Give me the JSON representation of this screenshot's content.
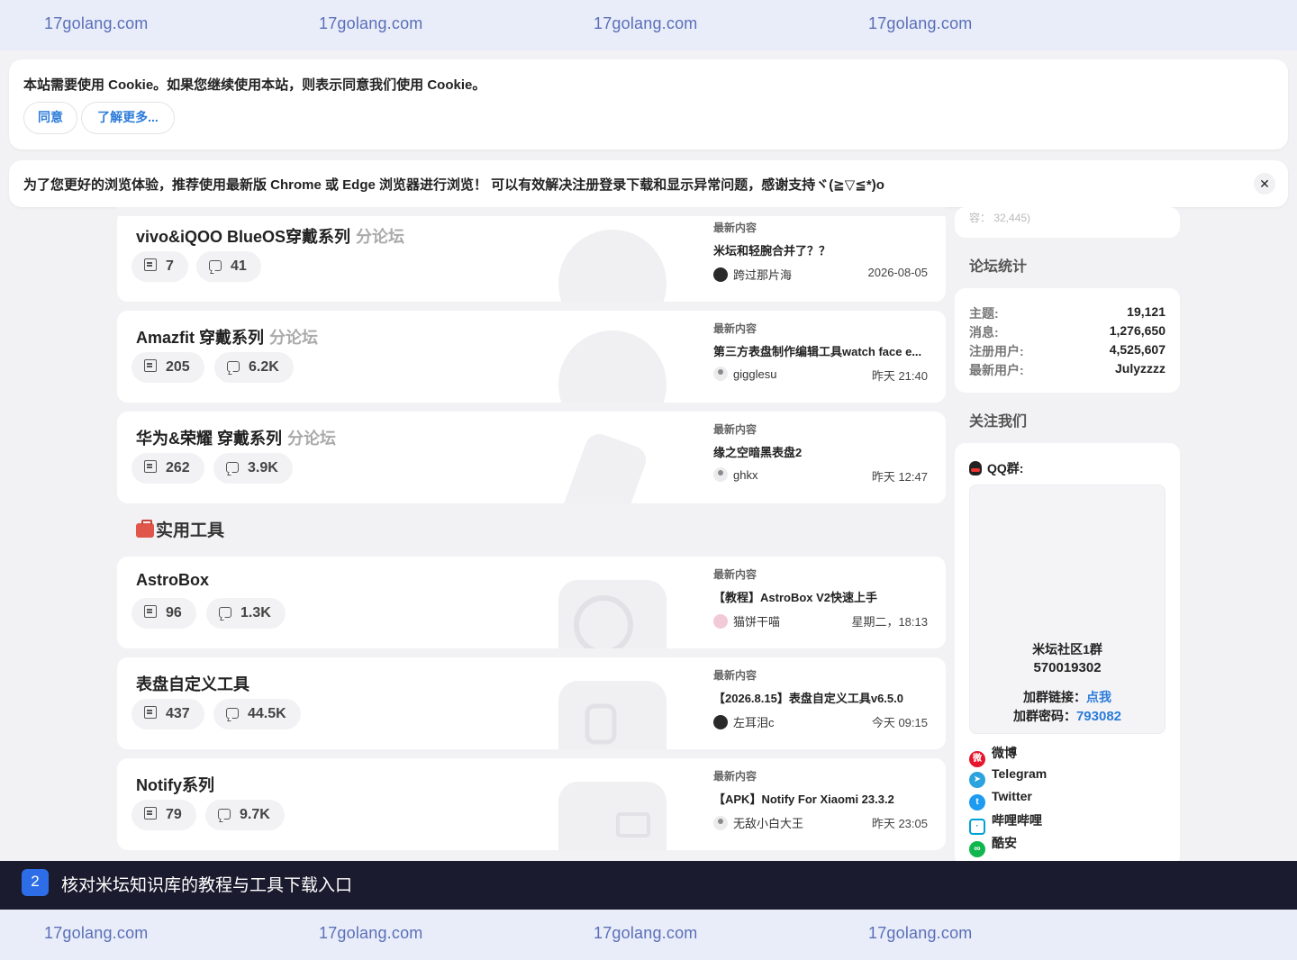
{
  "watermark": {
    "text": "17golang.com"
  },
  "cookie": {
    "message": "本站需要使用 Cookie。如果您继续使用本站，则表示同意我们使用 Cookie。",
    "agree_label": "同意",
    "more_label": "了解更多..."
  },
  "notice": {
    "message": "为了您更好的浏览体验，推荐使用最新版 Chrome 或 Edge 浏览器进行浏览！ 可以有效解决注册登录下载和显示异常问题，感谢支持ヾ(≧▽≦*)o",
    "close_glyph": "✕"
  },
  "latest_label": "最新内容",
  "section_tools": {
    "title": "实用工具"
  },
  "forums": [
    {
      "name": "vivo&iQOO BlueOS穿戴系列",
      "sub": "分论坛",
      "threads": "7",
      "posts": "41",
      "latest_title": "米坛和轻腕合并了？？",
      "latest_user": "跨过那片海",
      "latest_time": "2026-08-05"
    },
    {
      "name": "Amazfit 穿戴系列",
      "sub": "分论坛",
      "threads": "205",
      "posts": "6.2K",
      "latest_title": "第三方表盘制作编辑工具watch face e...",
      "latest_user": "gigglesu",
      "latest_time": "昨天 21:40"
    },
    {
      "name": "华为&荣耀 穿戴系列",
      "sub": "分论坛",
      "threads": "262",
      "posts": "3.9K",
      "latest_title": "缘之空暗黑表盘2",
      "latest_user": "ghkx",
      "latest_time": "昨天 12:47"
    }
  ],
  "tools": [
    {
      "name": "AstroBox",
      "threads": "96",
      "posts": "1.3K",
      "latest_title": "【教程】AstroBox V2快速上手",
      "latest_user": "猫饼干喵",
      "latest_time": "星期二，18:13"
    },
    {
      "name": "表盘自定义工具",
      "threads": "437",
      "posts": "44.5K",
      "latest_title": "【2026.8.15】表盘自定义工具v6.5.0",
      "latest_user": "左耳泪c",
      "latest_time": "今天 09:15"
    },
    {
      "name": "Notify系列",
      "threads": "79",
      "posts": "9.7K",
      "latest_title": "【APK】Notify For Xiaomi 23.3.2",
      "latest_user": "无敌小白大王",
      "latest_time": "昨天 23:05"
    }
  ],
  "sidebar": {
    "partial_text": "容： 32,445)",
    "stats_title": "论坛统计",
    "stats": [
      {
        "label": "主题:",
        "value": "19,121"
      },
      {
        "label": "消息:",
        "value": "1,276,650"
      },
      {
        "label": "注册用户:",
        "value": "4,525,607"
      },
      {
        "label": "最新用户:",
        "value": "Julyzzzz"
      }
    ],
    "follow_title": "关注我们",
    "qq": {
      "label": "QQ群:",
      "group_name": "米坛社区1群",
      "group_number": "570019302",
      "link_label": "加群链接：",
      "link_text": "点我",
      "pwd_label": "加群密码：",
      "pwd_value": "793082"
    },
    "socials": [
      {
        "name": "微博",
        "color": "#e6162d",
        "icon": "weibo-icon"
      },
      {
        "name": "Telegram",
        "color": "#2aa3df",
        "icon": "telegram-icon"
      },
      {
        "name": "Twitter",
        "color": "#1d9bf0",
        "icon": "twitter-icon"
      },
      {
        "name": "哔哩哔哩",
        "color": "#00a1d6",
        "icon": "bilibili-icon"
      },
      {
        "name": "酷安",
        "color": "#11b64e",
        "icon": "coolapk-icon"
      }
    ]
  },
  "instruction": {
    "step": "2",
    "text": "核对米坛知识库的教程与工具下载入口"
  }
}
